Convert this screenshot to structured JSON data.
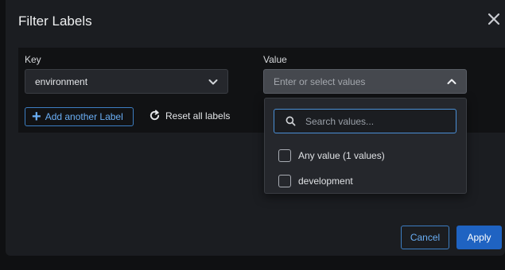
{
  "modal": {
    "title": "Filter Labels"
  },
  "key": {
    "label": "Key",
    "selected": "environment"
  },
  "value": {
    "label": "Value",
    "placeholder": "Enter or select values"
  },
  "actions": {
    "add_label": "Add another Label",
    "reset_labels": "Reset all labels"
  },
  "dropdown": {
    "search_placeholder": "Search values...",
    "options": [
      {
        "label": "Any value (1 values)",
        "checked": false
      },
      {
        "label": "development",
        "checked": false
      }
    ]
  },
  "footer": {
    "cancel_label": "Cancel",
    "apply_label": "Apply"
  },
  "colors": {
    "accent": "#1f63c2",
    "link": "#6aaef5",
    "background": "#1b1d21"
  }
}
